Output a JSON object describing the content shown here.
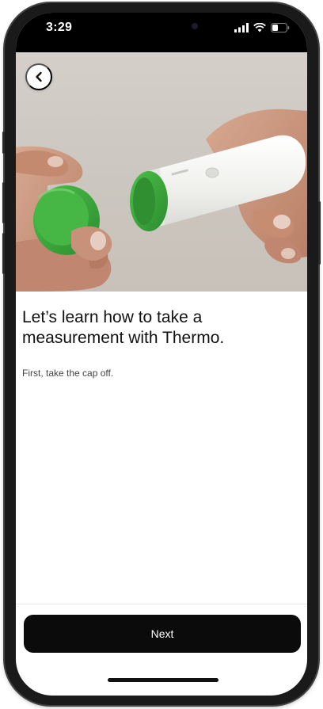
{
  "status_bar": {
    "time": "3:29",
    "icons": [
      "signal-icon",
      "wifi-icon",
      "battery-icon"
    ]
  },
  "hero": {
    "back_icon": "chevron-left-icon",
    "image_subject": "hands-removing-green-cap-from-thermometer",
    "colors": {
      "cap_green": "#3aa53c",
      "device_white": "#f2f2f0"
    }
  },
  "content": {
    "heading": "Let’s learn how to take a measurement with Thermo.",
    "subtext": "First, take the cap off."
  },
  "footer": {
    "next_label": "Next",
    "button_color": "#0b0b0b"
  }
}
